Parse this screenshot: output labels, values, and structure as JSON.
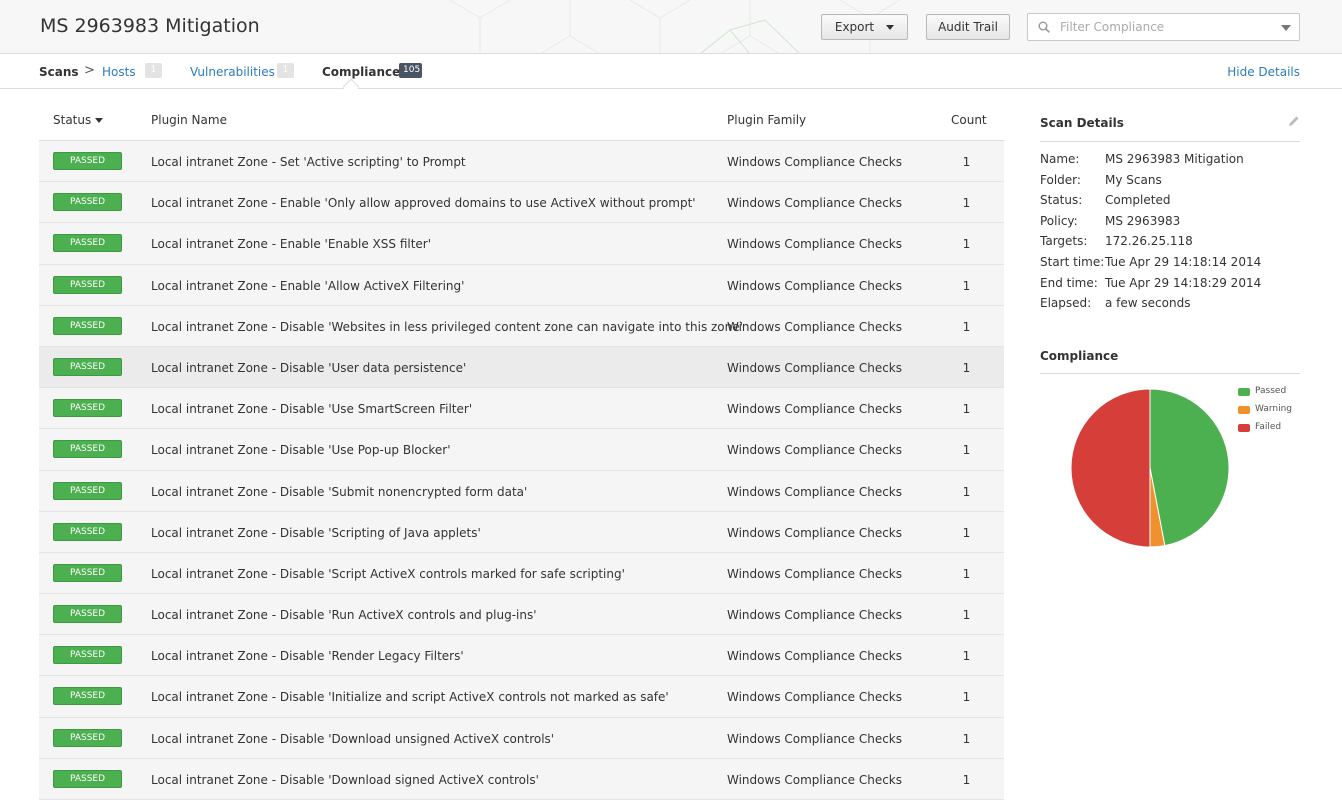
{
  "header": {
    "title": "MS 2963983 Mitigation",
    "export_label": "Export",
    "audit_label": "Audit Trail",
    "filter_placeholder": "Filter Compliance"
  },
  "tabs": {
    "scans_label": "Scans",
    "separator": ">",
    "hosts_label": "Hosts",
    "hosts_count": "1",
    "vulns_label": "Vulnerabilities",
    "vulns_count": "1",
    "comp_label": "Compliance",
    "comp_count": "105",
    "hide_details": "Hide Details"
  },
  "table": {
    "headers": {
      "status": "Status",
      "plugin_name": "Plugin Name",
      "plugin_family": "Plugin Family",
      "count": "Count"
    },
    "rows": [
      {
        "status": "PASSED",
        "name": "Local intranet Zone - Set 'Active scripting' to Prompt",
        "family": "Windows Compliance Checks",
        "count": "1"
      },
      {
        "status": "PASSED",
        "name": "Local intranet Zone - Enable 'Only allow approved domains to use ActiveX without prompt'",
        "family": "Windows Compliance Checks",
        "count": "1"
      },
      {
        "status": "PASSED",
        "name": "Local intranet Zone - Enable 'Enable XSS filter'",
        "family": "Windows Compliance Checks",
        "count": "1"
      },
      {
        "status": "PASSED",
        "name": "Local intranet Zone - Enable 'Allow ActiveX Filtering'",
        "family": "Windows Compliance Checks",
        "count": "1"
      },
      {
        "status": "PASSED",
        "name": "Local intranet Zone - Disable 'Websites in less privileged content zone can navigate into this zone'",
        "family": "Windows Compliance Checks",
        "count": "1"
      },
      {
        "status": "PASSED",
        "name": "Local intranet Zone - Disable 'User data persistence'",
        "family": "Windows Compliance Checks",
        "count": "1"
      },
      {
        "status": "PASSED",
        "name": "Local intranet Zone - Disable 'Use SmartScreen Filter'",
        "family": "Windows Compliance Checks",
        "count": "1"
      },
      {
        "status": "PASSED",
        "name": "Local intranet Zone - Disable 'Use Pop-up Blocker'",
        "family": "Windows Compliance Checks",
        "count": "1"
      },
      {
        "status": "PASSED",
        "name": "Local intranet Zone - Disable 'Submit nonencrypted form data'",
        "family": "Windows Compliance Checks",
        "count": "1"
      },
      {
        "status": "PASSED",
        "name": "Local intranet Zone - Disable 'Scripting of Java applets'",
        "family": "Windows Compliance Checks",
        "count": "1"
      },
      {
        "status": "PASSED",
        "name": "Local intranet Zone - Disable 'Script ActiveX controls marked for safe scripting'",
        "family": "Windows Compliance Checks",
        "count": "1"
      },
      {
        "status": "PASSED",
        "name": "Local intranet Zone - Disable 'Run ActiveX controls and plug-ins'",
        "family": "Windows Compliance Checks",
        "count": "1"
      },
      {
        "status": "PASSED",
        "name": "Local intranet Zone - Disable 'Render Legacy Filters'",
        "family": "Windows Compliance Checks",
        "count": "1"
      },
      {
        "status": "PASSED",
        "name": "Local intranet Zone - Disable 'Initialize and script ActiveX controls not marked as safe'",
        "family": "Windows Compliance Checks",
        "count": "1"
      },
      {
        "status": "PASSED",
        "name": "Local intranet Zone - Disable 'Download unsigned ActiveX controls'",
        "family": "Windows Compliance Checks",
        "count": "1"
      },
      {
        "status": "PASSED",
        "name": "Local intranet Zone - Disable 'Download signed ActiveX controls'",
        "family": "Windows Compliance Checks",
        "count": "1"
      }
    ]
  },
  "scan_details": {
    "title": "Scan Details",
    "items": [
      {
        "key": "Name:",
        "value": "MS 2963983 Mitigation"
      },
      {
        "key": "Folder:",
        "value": "My Scans"
      },
      {
        "key": "Status:",
        "value": "Completed"
      },
      {
        "key": "Policy:",
        "value": "MS 2963983"
      },
      {
        "key": "Targets:",
        "value": "172.26.25.118"
      },
      {
        "key": "Start time:",
        "value": "Tue Apr 29 14:18:14 2014"
      },
      {
        "key": "End time:",
        "value": "Tue Apr 29 14:18:29 2014"
      },
      {
        "key": "Elapsed:",
        "value": "a few seconds"
      }
    ]
  },
  "compliance": {
    "title": "Compliance",
    "legend": [
      {
        "label": "Passed",
        "color": "#4caf50"
      },
      {
        "label": "Warning",
        "color": "#f0912f"
      },
      {
        "label": "Failed",
        "color": "#d63e3a"
      }
    ]
  },
  "chart_data": {
    "type": "pie",
    "categories": [
      "Passed",
      "Warning",
      "Failed"
    ],
    "values": [
      47,
      3,
      50
    ],
    "colors": [
      "#4caf50",
      "#f0912f",
      "#d63e3a"
    ],
    "legend": "right"
  },
  "icons": {
    "search": "search-icon",
    "edit": "pencil-icon",
    "export_caret": "caret-down-icon",
    "filter_dropdown": "caret-down-icon",
    "sort": "sort-down-icon"
  }
}
